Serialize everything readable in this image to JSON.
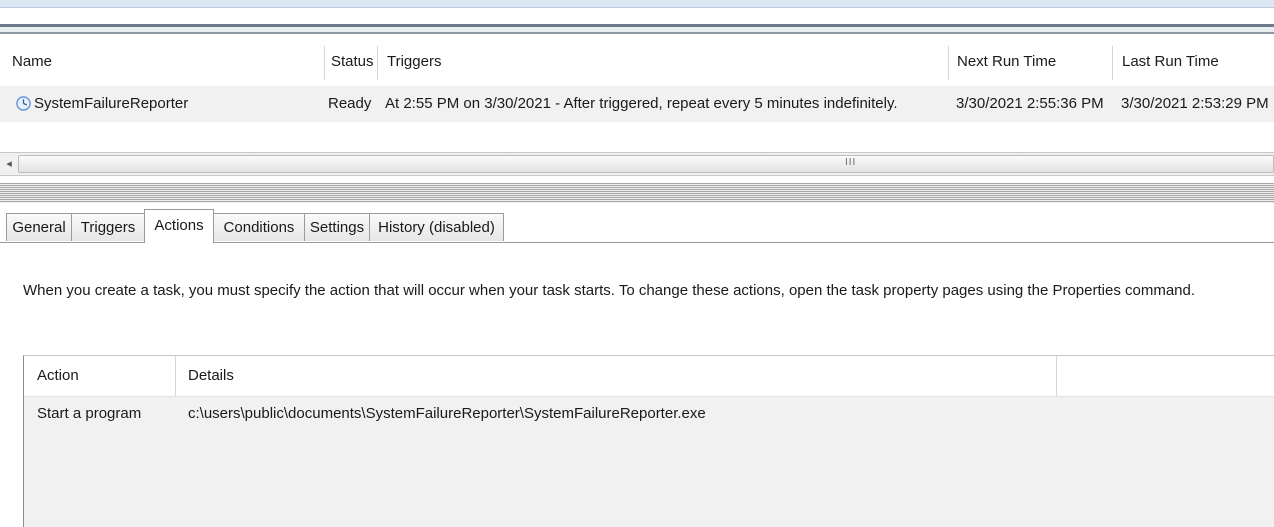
{
  "tasks_list": {
    "columns": {
      "name": "Name",
      "status": "Status",
      "triggers": "Triggers",
      "next_run": "Next Run Time",
      "last_run": "Last Run Time"
    },
    "rows": [
      {
        "icon": "clock-icon",
        "name": "SystemFailureReporter",
        "status": "Ready",
        "triggers": "At 2:55 PM on 3/30/2021 - After triggered, repeat every 5 minutes indefinitely.",
        "next_run": "3/30/2021 2:55:36 PM",
        "last_run": "3/30/2021 2:53:29 PM"
      }
    ],
    "scrollbar": {
      "left_arrow": "◂",
      "grip": "III"
    }
  },
  "tabs": [
    {
      "label": "General",
      "active": false
    },
    {
      "label": "Triggers",
      "active": false
    },
    {
      "label": "Actions",
      "active": true
    },
    {
      "label": "Conditions",
      "active": false
    },
    {
      "label": "Settings",
      "active": false
    },
    {
      "label": "History (disabled)",
      "active": false
    }
  ],
  "actions_panel": {
    "description": "When you create a task, you must specify the action that will occur when your task starts.  To change these actions, open the task property pages using the Properties command.",
    "columns": {
      "action": "Action",
      "details": "Details"
    },
    "rows": [
      {
        "action": "Start a program",
        "details": "c:\\users\\public\\documents\\SystemFailureReporter\\SystemFailureReporter.exe"
      }
    ]
  },
  "colors": {
    "row_background": "#f1f1f1",
    "clock_icon": "#5b8fd6"
  }
}
